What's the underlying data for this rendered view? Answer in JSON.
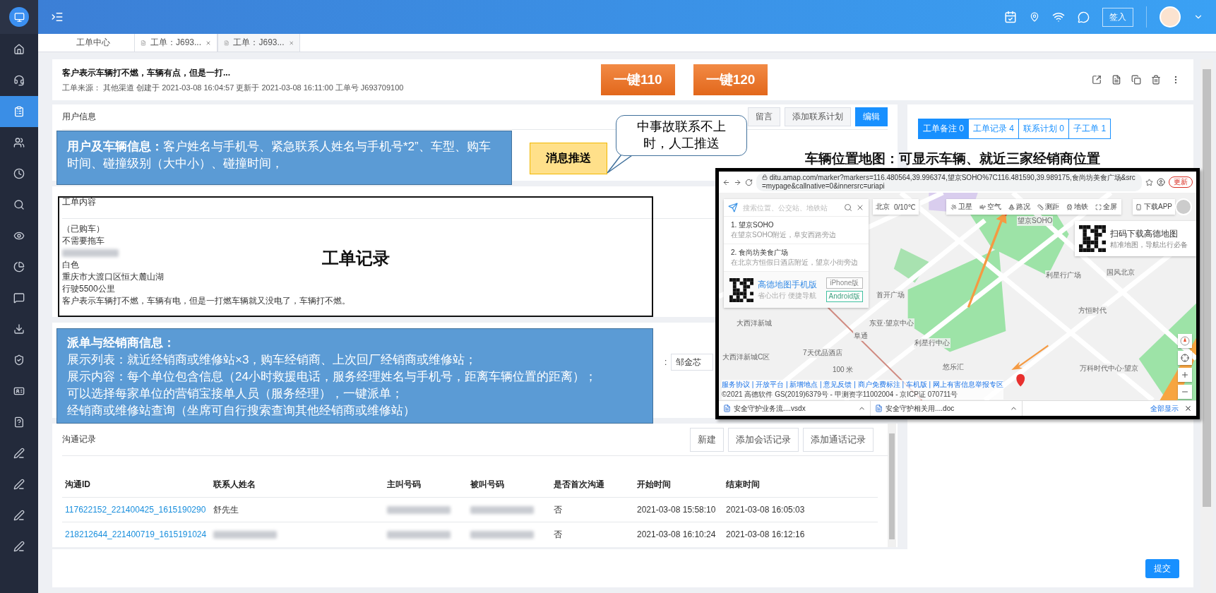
{
  "topbar": {
    "sign_in": "签入"
  },
  "sidebar": {
    "items": [
      {
        "selected": false
      },
      {
        "selected": false
      },
      {
        "selected": true
      },
      {
        "selected": false
      },
      {
        "selected": false
      },
      {
        "selected": false
      },
      {
        "selected": false
      },
      {
        "selected": false
      },
      {
        "selected": false
      },
      {
        "selected": false
      },
      {
        "selected": false
      },
      {
        "selected": false
      },
      {
        "selected": false
      },
      {
        "selected": false
      },
      {
        "selected": false
      },
      {
        "selected": false
      },
      {
        "selected": false
      }
    ]
  },
  "tabs": [
    {
      "label": "工单中心",
      "selected": false,
      "closable": false
    },
    {
      "label": "工单：J693...",
      "selected": false,
      "closable": true
    },
    {
      "label": "工单：J693...",
      "selected": true,
      "closable": true
    }
  ],
  "ticket": {
    "title": "客户表示车辆打不燃，车辆有点，但是一打...",
    "meta": "工单来源： 其他渠道 创建于 2021-03-08 16:04:57 更新于 2021-03-08 16:11:00 工单号 J693709100",
    "quick_buttons": [
      "一键110",
      "一键120"
    ]
  },
  "user_info": {
    "title": "用户信息",
    "buttons": [
      {
        "label": "留言",
        "primary": false
      },
      {
        "label": "添加联系计划",
        "primary": false
      },
      {
        "label": "编辑",
        "primary": true
      }
    ]
  },
  "content": {
    "title": "工单内容",
    "lines": [
      {
        "kind": "text",
        "text": "（已购车）"
      },
      {
        "kind": "text",
        "text": "不需要拖车"
      },
      {
        "kind": "blurred"
      },
      {
        "kind": "text",
        "text": "白色"
      },
      {
        "kind": "text",
        "text": "重庆市大渡口区恒大麓山湖"
      },
      {
        "kind": "text",
        "text": "行驶5500公里"
      },
      {
        "kind": "text",
        "text": "客户表示车辆打不燃，车辆有电，但是一打燃车辆就又没电了，车辆打不燃。"
      }
    ]
  },
  "dispatch": {
    "field_label": ":",
    "field_value": "邹金芯"
  },
  "communications": {
    "title": "沟通记录",
    "buttons": [
      "新建",
      "添加会话记录",
      "添加通话记录"
    ],
    "columns": [
      "沟通ID",
      "联系人姓名",
      "主叫号码",
      "被叫号码",
      "是否首次沟通",
      "开始时间",
      "结束时间"
    ],
    "rows": [
      {
        "cells": [
          {
            "kind": "link",
            "text": "117622152_221400425_1615190290"
          },
          {
            "kind": "text",
            "text": "舒先生"
          },
          {
            "kind": "blurred"
          },
          {
            "kind": "blurred"
          },
          {
            "kind": "text",
            "text": "否"
          },
          {
            "kind": "text",
            "text": "2021-03-08 15:58:10"
          },
          {
            "kind": "text",
            "text": "2021-03-08 16:05:03"
          }
        ]
      },
      {
        "cells": [
          {
            "kind": "link",
            "text": "218212644_221400719_1615191024"
          },
          {
            "kind": "blurred"
          },
          {
            "kind": "blurred"
          },
          {
            "kind": "blurred"
          },
          {
            "kind": "text",
            "text": "否"
          },
          {
            "kind": "text",
            "text": "2021-03-08 16:10:24"
          },
          {
            "kind": "text",
            "text": "2021-03-08 16:12:16"
          }
        ]
      }
    ]
  },
  "side_tabs": [
    {
      "label": "工单备注 0",
      "selected": true
    },
    {
      "label": "工单记录 4",
      "selected": false
    },
    {
      "label": "联系计划 0",
      "selected": false
    },
    {
      "label": "子工单 1",
      "selected": false
    }
  ],
  "footer": {
    "submit": "提交"
  },
  "annotations": {
    "user_vehicle": "**用户及车辆信息：**客户姓名与手机号、紧急联系人姓名与手机号*2”、车型、购车时间、碰撞级别（大中小）、碰撞时间，",
    "message_push": "消息推送",
    "callout": "中事故联系不上时，人工推送",
    "record_label": "工单记录",
    "map_heading": "车辆位置地图：可显示车辆、就近三家经销商位置",
    "dispatch_title": "派单与经销商信息：",
    "dispatch_lines": [
      "展示列表：就近经销商或维修站×3，购车经销商、上次回厂经销商或维修站；",
      "展示内容：每个单位包含信息（24小时救援电话，服务经理姓名与手机号，距离车辆位置的距离）；",
      "可以选择每家单位的营销宝接单人员（服务经理），一键派单；",
      "经销商或维修站查询（坐席可自行搜索查询其他经销商或维修站）"
    ]
  },
  "map_screenshot": {
    "url": "ditu.amap.com/marker?markers=116.480564,39.996374,望京SOHO%7C116.481590,39.989175,食尚坊美食广场&src=mypage&callnative=0&innersrc=uriapi",
    "update": "更新",
    "search_placeholder": "搜索位置、公交站、地铁站",
    "city": "北京",
    "weather": "0/10℃",
    "results": [
      {
        "title": "1. 望京SOHO",
        "desc": "在望京SOHO附近，阜安西路旁边"
      },
      {
        "title": "2. 食尚坊美食广场",
        "desc": "在北京方恒假日酒店附近，望京小街旁边"
      }
    ],
    "promo": {
      "title": "高德地图手机版",
      "subtitle": "省心出行 便捷导航",
      "buttons": [
        "iPhone版",
        "Android版"
      ]
    },
    "tools": [
      "卫星",
      "空气",
      "路况",
      "测距",
      "地铁",
      "全屏"
    ],
    "download_app": "下载APP",
    "qr_popup": {
      "title": "扫码下载高德地图",
      "subtitle": "精准地图，导航出行必备"
    },
    "labels": [
      "望京SOHO",
      "利星行广场",
      "首开广场",
      "方恒时代",
      "东亚·望京中心",
      "利星行中心",
      "7天优品酒店",
      "阜通",
      "悠乐汇",
      "万科时代中心·望京",
      "大西洋新城",
      "大西洋新城C区",
      "国风北京",
      "100 米"
    ],
    "copyright": "©2021 高德软件 GS(2019)6379号 - 甲测资字11002004 - 京ICP证 070711号",
    "links": "服务协议 | 开放平台 | 新增地点 | 意见反馈 | 商户免费标注 | 车机版 | 网上有害信息举报专区",
    "downloads": [
      "安全守护业务流....vsdx",
      "安全守护相关用....doc"
    ],
    "show_all": "全部显示"
  }
}
